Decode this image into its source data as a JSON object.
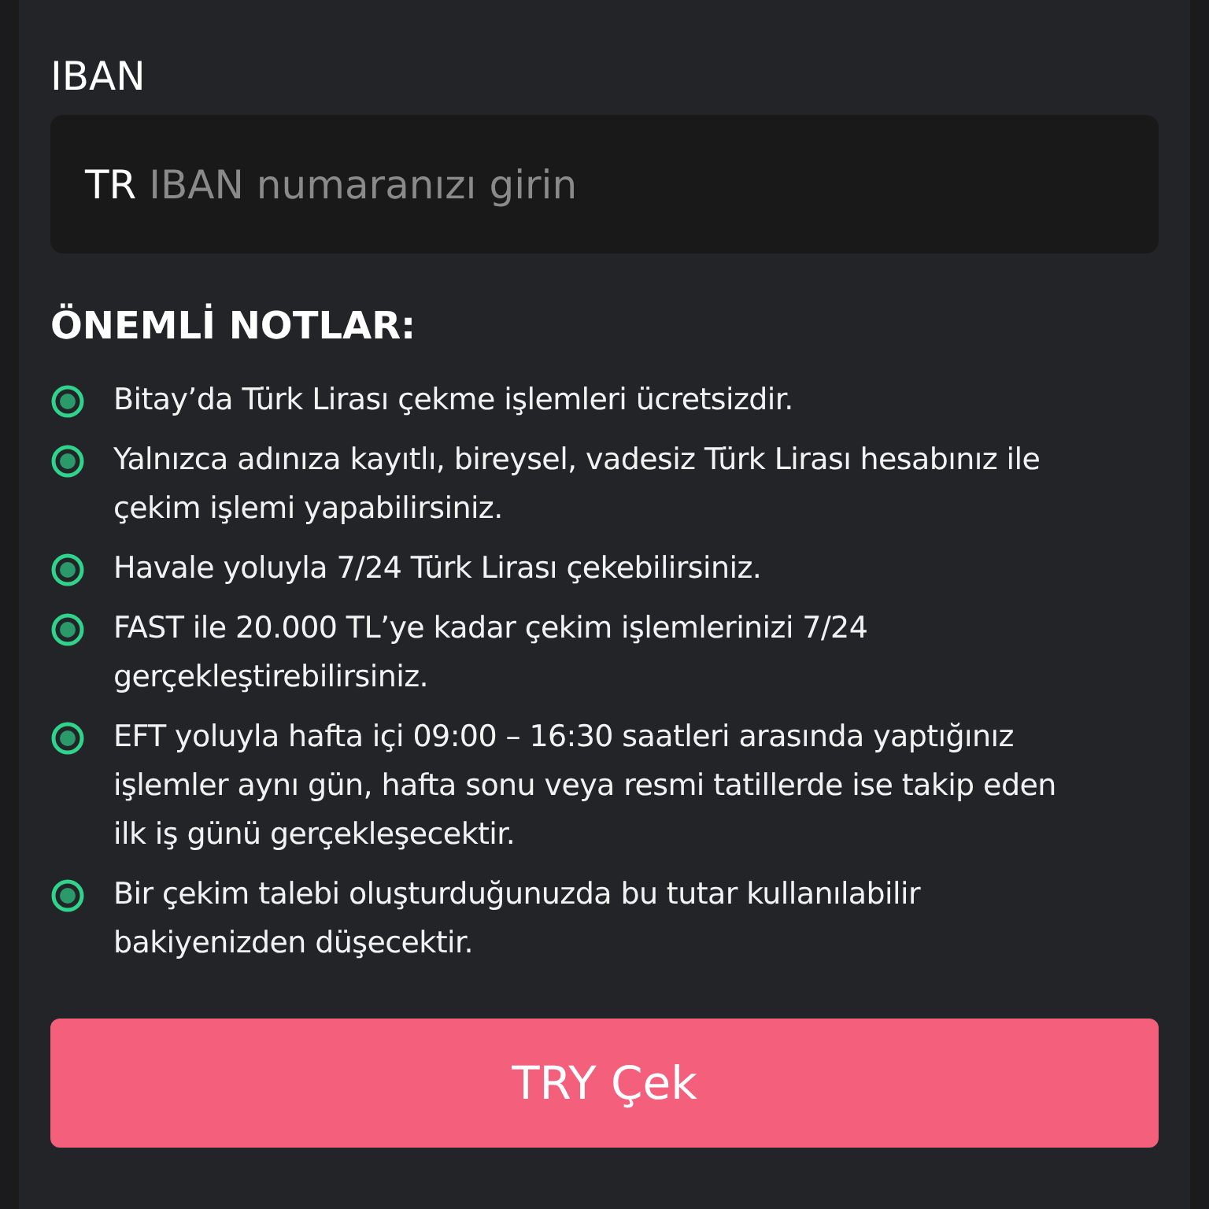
{
  "iban": {
    "label": "IBAN",
    "prefix": "TR",
    "placeholder": "IBAN numaranızı girin"
  },
  "notes": {
    "title": "ÖNEMLİ NOTLAR:",
    "items": [
      "Bitay’da Türk Lirası çekme işlemleri ücretsizdir.",
      "Yalnızca adınıza kayıtlı, bireysel, vadesiz Türk Lirası hesabınız ile çekim işlemi yapabilirsiniz.",
      "Havale yoluyla 7/24 Türk Lirası çekebilirsiniz.",
      "FAST ile 20.000 TL’ye kadar çekim işlemlerinizi 7/24 gerçekleştirebilirsiniz.",
      "EFT yoluyla hafta içi 09:00 – 16:30 saatleri arasında yaptığınız işlemler aynı gün, hafta sonu veya resmi tatillerde ise takip eden ilk iş günü gerçekleşecektir.",
      "Bir çekim talebi oluşturduğunuzda bu tutar kullanılabilir bakiyenizden düşecektir."
    ]
  },
  "submit": {
    "label": "TRY Çek"
  }
}
